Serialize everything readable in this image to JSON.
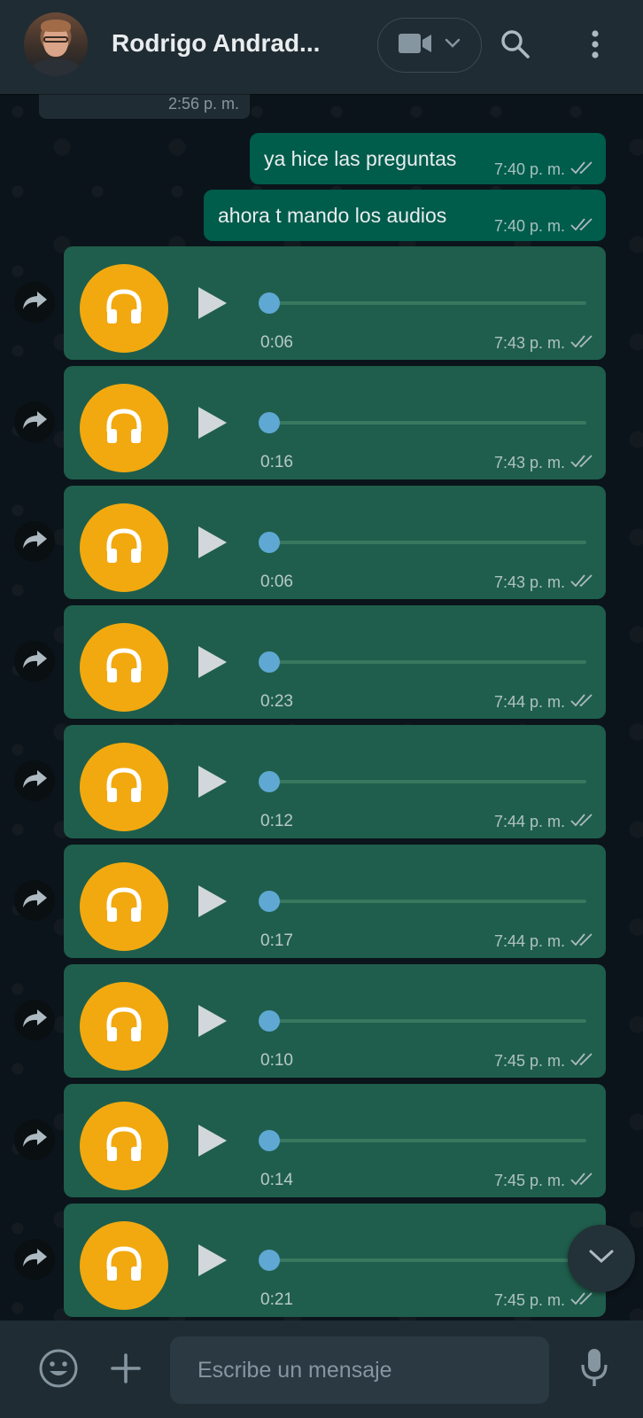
{
  "header": {
    "contact_name": "Rodrigo Andrad...",
    "icons": [
      "video-call-icon",
      "chevron-down-icon",
      "search-icon",
      "menu-icon"
    ]
  },
  "previous_message": {
    "time": "2:56 p. m."
  },
  "text_messages": [
    {
      "text": "ya hice las preguntas",
      "time": "7:40 p. m."
    },
    {
      "text": "ahora t mando los audios",
      "time": "7:40 p. m."
    }
  ],
  "audio_messages": [
    {
      "duration": "0:06",
      "time": "7:43 p. m."
    },
    {
      "duration": "0:16",
      "time": "7:43 p. m."
    },
    {
      "duration": "0:06",
      "time": "7:43 p. m."
    },
    {
      "duration": "0:23",
      "time": "7:44 p. m."
    },
    {
      "duration": "0:12",
      "time": "7:44 p. m."
    },
    {
      "duration": "0:17",
      "time": "7:44 p. m."
    },
    {
      "duration": "0:10",
      "time": "7:45 p. m."
    },
    {
      "duration": "0:14",
      "time": "7:45 p. m."
    },
    {
      "duration": "0:21",
      "time": "7:45 p. m."
    }
  ],
  "composer": {
    "placeholder": "Escribe un mensaje",
    "icons": [
      "emoji-icon",
      "attach-plus-icon",
      "microphone-icon"
    ]
  },
  "colors": {
    "header_bg": "#202c33",
    "outgoing_bubble": "#005c4b",
    "audio_bubble": "#1f5e4c",
    "headphones_circle": "#f2a90f",
    "progress_knob": "#5fa8d3"
  }
}
